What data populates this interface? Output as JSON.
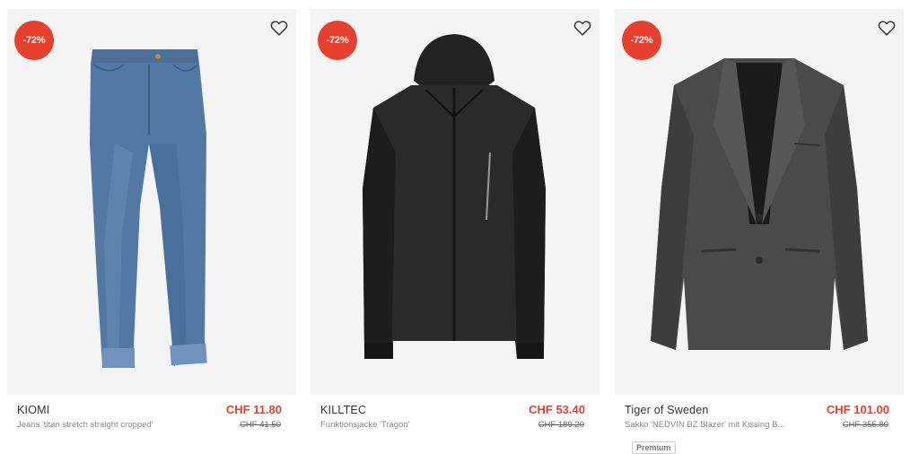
{
  "products": [
    {
      "badge": "-72%",
      "brand": "KIOMI",
      "description": "Jeans 'titan stretch straight cropped'",
      "price": "CHF 11.80",
      "old_price": "CHF 41.50",
      "image": "jeans"
    },
    {
      "badge": "-72%",
      "brand": "KILLTEC",
      "description": "Funktionsjacke 'Tragon'",
      "price": "CHF 53.40",
      "old_price": "CHF 189.20",
      "image": "jacket"
    },
    {
      "badge": "-72%",
      "brand": "Tiger of Sweden",
      "description": "Sakko 'NEDVIN BZ Blazer' mit Kissing B...",
      "price": "CHF 101.00",
      "old_price": "CHF 355.80",
      "tag": "Premium",
      "image": "blazer"
    }
  ],
  "icons": {
    "wishlist": "heart-icon"
  },
  "colors": {
    "badge": "#e8402f",
    "sale_price": "#e8402f",
    "card_bg": "#f4f4f4"
  }
}
